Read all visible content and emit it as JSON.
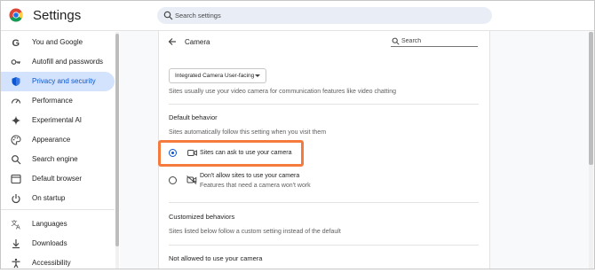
{
  "header": {
    "title": "Settings",
    "search_placeholder": "Search settings"
  },
  "sidebar": {
    "items": [
      {
        "label": "You and Google",
        "icon": "google-icon"
      },
      {
        "label": "Autofill and passwords",
        "icon": "key-icon"
      },
      {
        "label": "Privacy and security",
        "icon": "shield-icon",
        "active": true
      },
      {
        "label": "Performance",
        "icon": "speedometer-icon"
      },
      {
        "label": "Experimental AI",
        "icon": "sparkle-icon"
      },
      {
        "label": "Appearance",
        "icon": "palette-icon"
      },
      {
        "label": "Search engine",
        "icon": "search-icon"
      },
      {
        "label": "Default browser",
        "icon": "browser-icon"
      },
      {
        "label": "On startup",
        "icon": "power-icon"
      },
      {
        "label": "Languages",
        "icon": "translate-icon"
      },
      {
        "label": "Downloads",
        "icon": "download-icon"
      },
      {
        "label": "Accessibility",
        "icon": "accessibility-icon"
      }
    ]
  },
  "page": {
    "title": "Camera",
    "search_placeholder": "Search",
    "camera_select": "Integrated Camera User-facing",
    "camera_desc": "Sites usually use your video camera for communication features like video chatting",
    "default_heading": "Default behavior",
    "default_desc": "Sites automatically follow this setting when you visit them",
    "option_allow": "Sites can ask to use your camera",
    "option_block": "Don't allow sites to use your camera",
    "option_block_sub": "Features that need a camera won't work",
    "custom_heading": "Customized behaviors",
    "custom_desc": "Sites listed below follow a custom setting instead of the default",
    "not_allowed_heading": "Not allowed to use your camera"
  },
  "colors": {
    "accent": "#0b57d0",
    "active_bg": "#d3e3fd",
    "highlight": "#f47b3d"
  }
}
